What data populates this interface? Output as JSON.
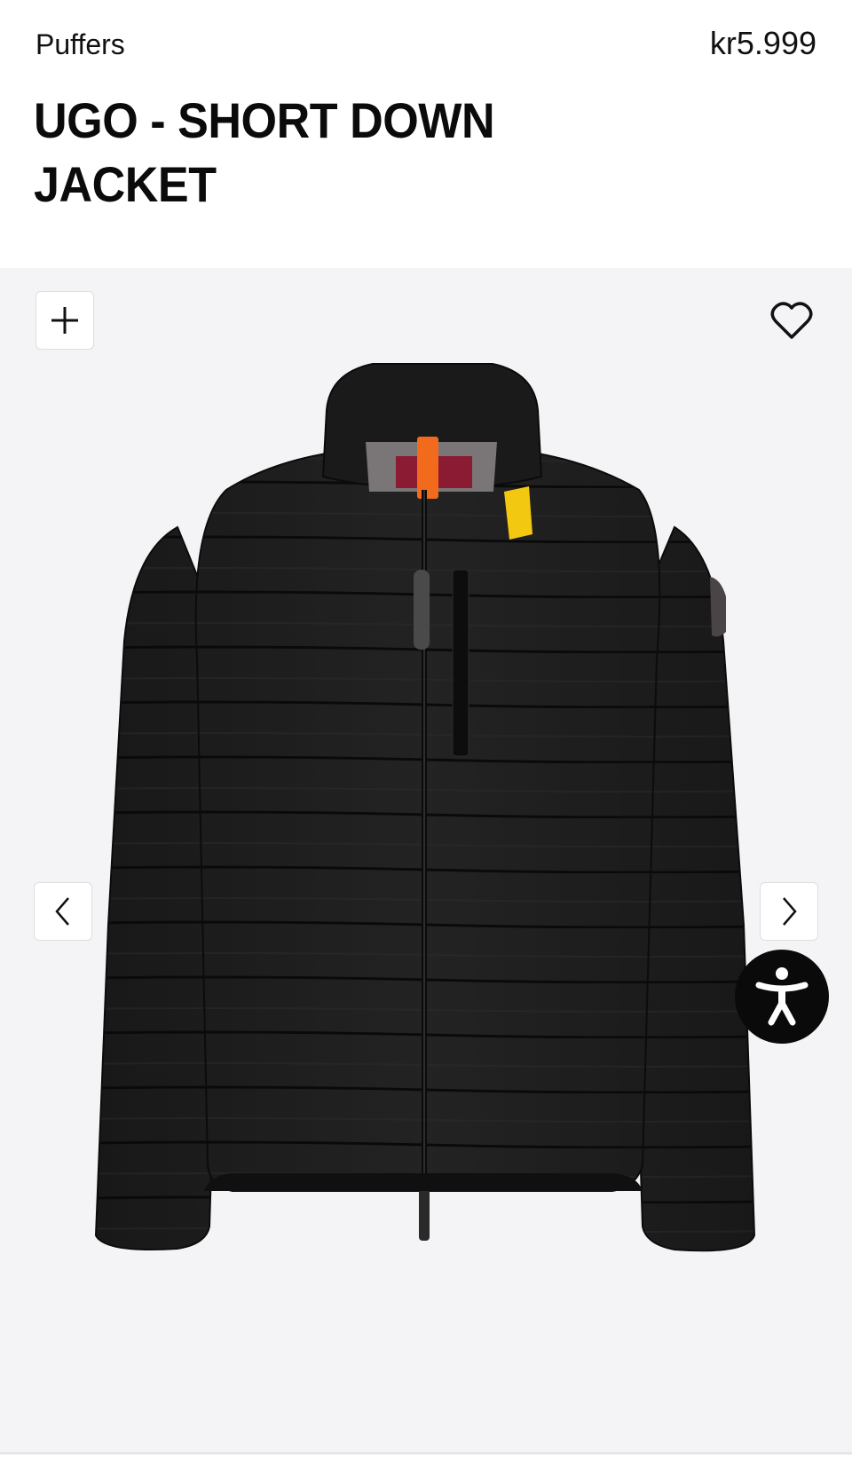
{
  "product": {
    "category": "Puffers",
    "price": "kr5.999",
    "title": "UGO - SHORT DOWN JACKET"
  },
  "gallery": {
    "image_icon": "black-puffer-jacket-image",
    "add_icon": "plus-icon",
    "favorite_icon": "heart-icon",
    "prev_icon": "chevron-left-icon",
    "next_icon": "chevron-right-icon",
    "accessibility_icon": "accessibility-icon"
  },
  "colors": {
    "gallery_background": "#f4f4f6",
    "jacket": "#1c1c1c",
    "zip_pull": "#f26b1d",
    "collar_tab": "#f2c811"
  }
}
